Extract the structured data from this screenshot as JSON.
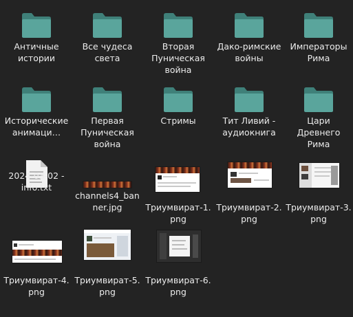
{
  "files": [
    {
      "type": "folder",
      "name": "Античные истории"
    },
    {
      "type": "folder",
      "name": "Все чудеса света"
    },
    {
      "type": "folder",
      "name": "Вторая Пуническая война"
    },
    {
      "type": "folder",
      "name": "Дако-римские войны"
    },
    {
      "type": "folder",
      "name": "Императоры Рима"
    },
    {
      "type": "folder",
      "name": "Исторические анимаци…"
    },
    {
      "type": "folder",
      "name": "Первая Пуническая война"
    },
    {
      "type": "folder",
      "name": "Стримы"
    },
    {
      "type": "folder",
      "name": "Тит Ливий - аудиокнига"
    },
    {
      "type": "folder",
      "name": "Цари Древнего Рима"
    },
    {
      "type": "text",
      "name": "2024-03-02 - info.txt"
    },
    {
      "type": "image",
      "name": "channels4_banner.jpg"
    },
    {
      "type": "image",
      "name": "Триумвират-1.png"
    },
    {
      "type": "image",
      "name": "Триумвират-2.png"
    },
    {
      "type": "image",
      "name": "Триумвират-3.png"
    },
    {
      "type": "image",
      "name": "Триумвират-4.png"
    },
    {
      "type": "image",
      "name": "Триумвират-5.png"
    },
    {
      "type": "image",
      "name": "Триумвират-6.png"
    }
  ],
  "colors": {
    "background": "#232323",
    "folder_back": "#3f8079",
    "folder_front": "#5aa59c",
    "label": "#ececec"
  }
}
